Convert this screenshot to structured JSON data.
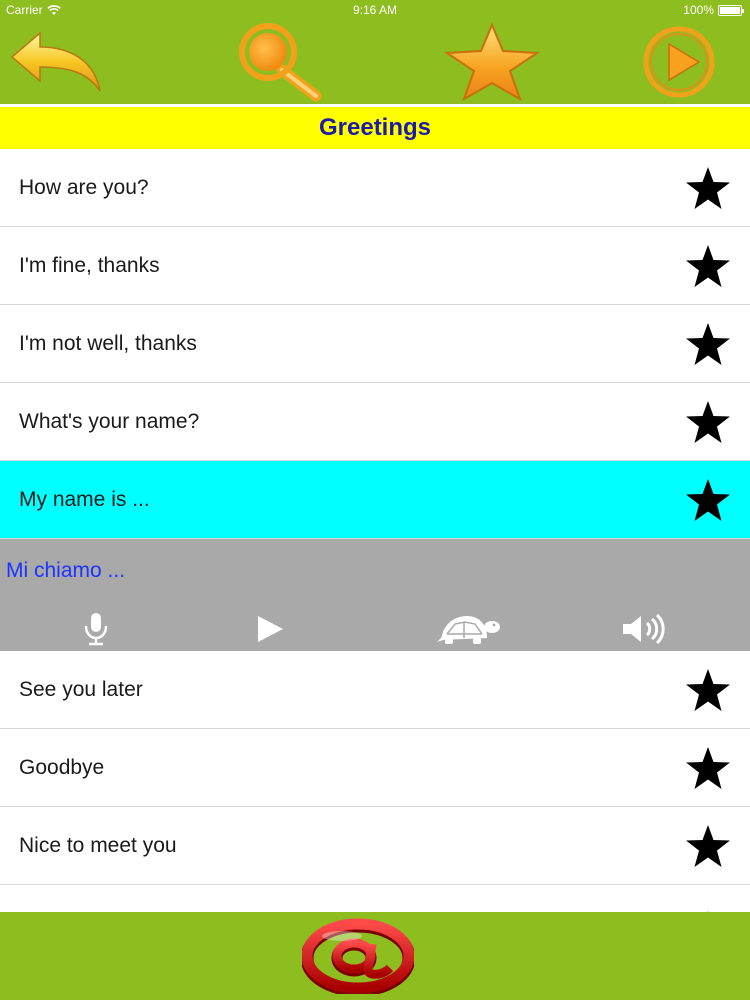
{
  "status_bar": {
    "carrier": "Carrier",
    "time": "9:16 AM",
    "battery": "100%"
  },
  "toolbar": {
    "icons": [
      "back-arrow-icon",
      "search-icon",
      "star-icon",
      "play-icon"
    ],
    "icon_color": "#f2a21a"
  },
  "category": {
    "title": "Greetings"
  },
  "phrases": [
    {
      "text": "How are you?"
    },
    {
      "text": "I'm fine, thanks"
    },
    {
      "text": "I'm not well, thanks"
    },
    {
      "text": "What's your name?"
    },
    {
      "text": "My name is ...",
      "selected": true
    }
  ],
  "selected_detail": {
    "translation": "Mi chiamo ...",
    "controls": [
      "microphone-icon",
      "play-icon",
      "turtle-icon",
      "speaker-icon"
    ]
  },
  "phrases_after": [
    {
      "text": "See you later"
    },
    {
      "text": "Goodbye"
    },
    {
      "text": "Nice to meet you"
    }
  ],
  "bottom_bar": {
    "icon": "at-sign-icon"
  },
  "colors": {
    "bar_green": "#8dbd1f",
    "title_band": "#ffff00",
    "title_text": "#1c1ca8",
    "selected_row": "#00ffff",
    "detail_panel": "#a9a9a9",
    "translation_text": "#1d33ff"
  }
}
